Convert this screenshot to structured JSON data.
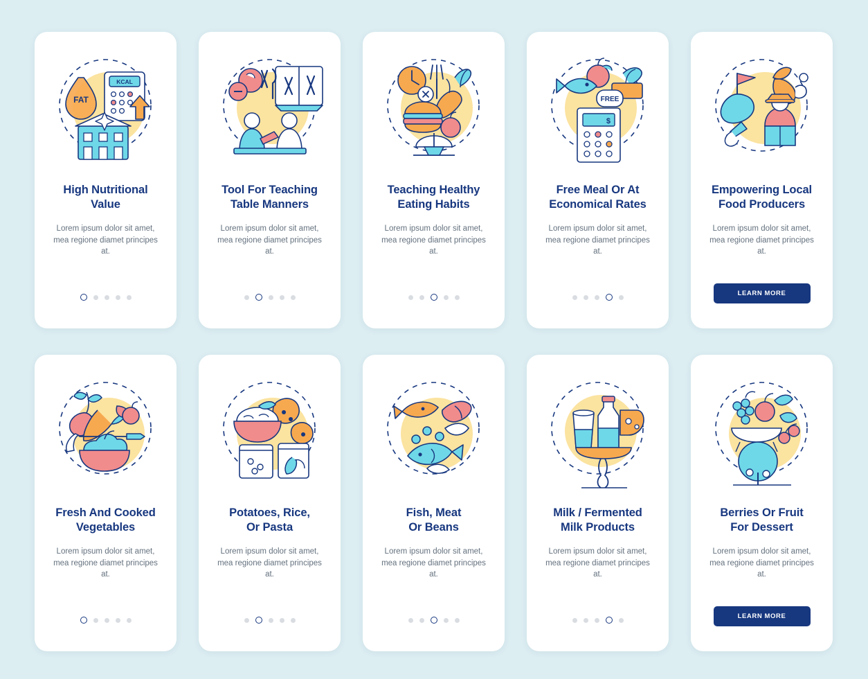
{
  "theme": {
    "background": "#dceef2",
    "card_bg": "#ffffff",
    "title_color": "#17377f",
    "body_color": "#64717e",
    "accent_yellow": "#fbe3a0",
    "accent_cyan": "#6fd8e8",
    "accent_pink": "#f08c8c",
    "dot_inactive": "#d9dde2"
  },
  "cards": [
    {
      "id": "high-nutritional-value",
      "title": "High Nutritional\nValue",
      "description": "Lorem ipsum dolor sit amet, mea regione diamet principes at.",
      "dots": {
        "count": 5,
        "active_index": 0
      },
      "button": null,
      "icon_name": "fat-kcal-school-icon"
    },
    {
      "id": "tool-for-teaching-table-manners",
      "title": "Tool For Teaching\nTable Manners",
      "description": "Lorem ipsum dolor sit amet, mea regione diamet principes at.",
      "dots": {
        "count": 5,
        "active_index": 1
      },
      "button": null,
      "icon_name": "cutlery-book-manners-icon"
    },
    {
      "id": "teaching-healthy-eating-habits",
      "title": "Teaching Healthy\nEating Habits",
      "description": "Lorem ipsum dolor sit amet, mea regione diamet principes at.",
      "dots": {
        "count": 5,
        "active_index": 2
      },
      "button": null,
      "icon_name": "burger-scale-vegetables-icon"
    },
    {
      "id": "free-meal-or-at-economical-rates",
      "title": "Free Meal Or At\nEconomical Rates",
      "description": "Lorem ipsum dolor sit amet, mea regione diamet principes at.",
      "dots": {
        "count": 5,
        "active_index": 3
      },
      "button": null,
      "icon_name": "fish-free-calculator-icon"
    },
    {
      "id": "empowering-local-food-producers",
      "title": "Empowering Local\nFood Producers",
      "description": "Lorem ipsum dolor sit amet, mea regione diamet principes at.",
      "dots": null,
      "button": "LEARN MORE",
      "icon_name": "farmer-local-produce-icon"
    },
    {
      "id": "fresh-and-cooked-vegetables",
      "title": "Fresh And Cooked\nVegetables",
      "description": "Lorem ipsum dolor sit amet, mea regione diamet principes at.",
      "dots": {
        "count": 5,
        "active_index": 0
      },
      "button": null,
      "icon_name": "fresh-cooked-vegetables-icon"
    },
    {
      "id": "potatoes-rice-or-pasta",
      "title": "Potatoes, Rice,\nOr Pasta",
      "description": "Lorem ipsum dolor sit amet, mea regione diamet principes at.",
      "dots": {
        "count": 5,
        "active_index": 1
      },
      "button": null,
      "icon_name": "potatoes-rice-pasta-icon"
    },
    {
      "id": "fish-meat-or-beans",
      "title": "Fish, Meat\nOr Beans",
      "description": "Lorem ipsum dolor sit amet, mea regione diamet principes at.",
      "dots": {
        "count": 5,
        "active_index": 2
      },
      "button": null,
      "icon_name": "fish-meat-beans-icon"
    },
    {
      "id": "milk-fermented-milk-products",
      "title": "Milk / Fermented\nMilk Products",
      "description": "Lorem ipsum dolor sit amet, mea regione diamet principes at.",
      "dots": {
        "count": 5,
        "active_index": 3
      },
      "button": null,
      "icon_name": "milk-cheese-products-icon"
    },
    {
      "id": "berries-or-fruit-for-dessert",
      "title": "Berries Or Fruit\nFor Dessert",
      "description": "Lorem ipsum dolor sit amet, mea regione diamet principes at.",
      "dots": null,
      "button": "LEARN MORE",
      "icon_name": "berries-fruit-dessert-icon"
    }
  ],
  "illustration_labels": {
    "fat": "FAT",
    "kcal": "KCAL",
    "free": "FREE"
  }
}
